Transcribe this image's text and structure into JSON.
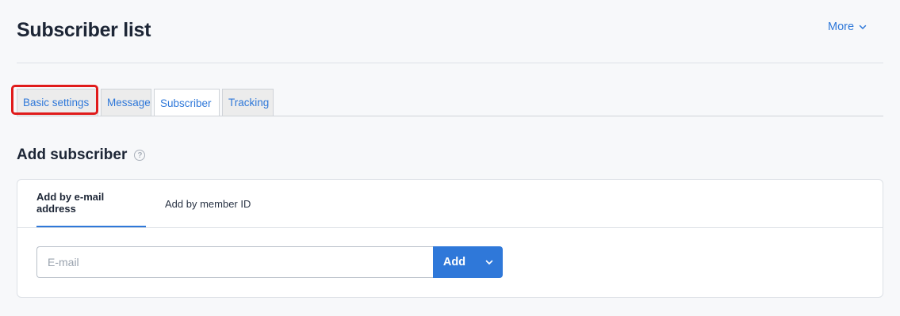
{
  "header": {
    "title": "Subscriber list",
    "more_label": "More",
    "more_icon": "chevron-down-icon"
  },
  "tabs": [
    {
      "label": "Basic settings",
      "active": false,
      "highlighted": true
    },
    {
      "label": "Message",
      "active": false
    },
    {
      "label": "Subscriber",
      "active": true
    },
    {
      "label": "Tracking",
      "active": false
    }
  ],
  "section": {
    "title": "Add subscriber",
    "help_icon": "question-circle-icon",
    "help_symbol": "?"
  },
  "card": {
    "tabs": [
      {
        "label": "Add by e-mail address",
        "active": true
      },
      {
        "label": "Add by member ID",
        "active": false
      }
    ],
    "email_input": {
      "placeholder": "E-mail",
      "value": ""
    },
    "add_button_label": "Add",
    "dropdown_icon": "chevron-down-icon"
  },
  "colors": {
    "accent": "#2f78d9",
    "highlight": "#e01b1b",
    "background": "#f7f8fa"
  }
}
